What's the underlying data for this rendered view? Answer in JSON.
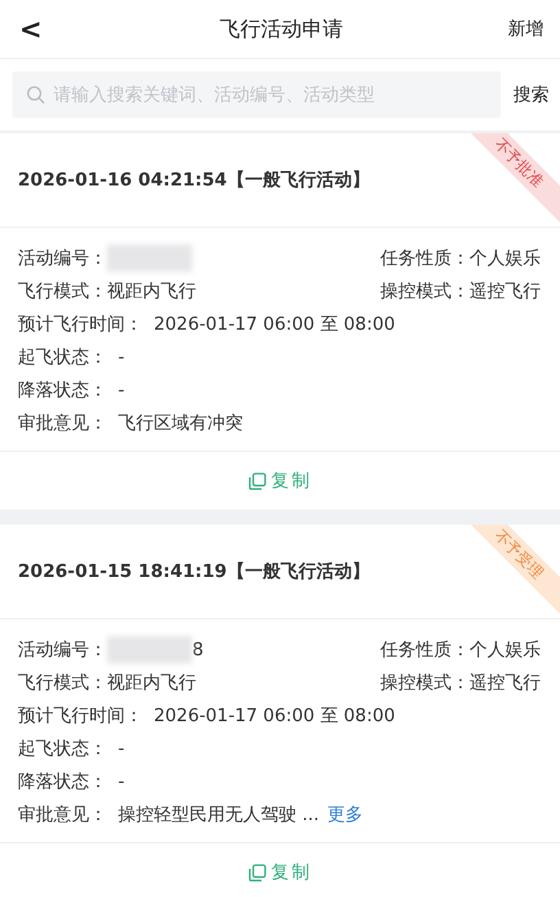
{
  "header": {
    "back": "<",
    "title": "飞行活动申请",
    "action": "新增"
  },
  "search": {
    "placeholder": "请输入搜索关键词、活动编号、活动类型",
    "button": "搜索"
  },
  "cards": [
    {
      "title": "2026-01-16 04:21:54【一般飞行活动】",
      "status": {
        "kind": "rejected",
        "text": "不予批准"
      },
      "number_label": "活动编号：",
      "number_redacted": true,
      "task_label": "任务性质：",
      "task": "个人娱乐",
      "flight_mode_label": "飞行模式：",
      "flight_mode": "视距内飞行",
      "control_label": "操控模式：",
      "control": "遥控飞行",
      "time_label": "预计飞行时间：",
      "time": "2026-01-17 06:00 至 08:00",
      "takeoff_label": "起飞状态：",
      "takeoff": "-",
      "landing_label": "降落状态：",
      "landing": "-",
      "opinion_label": "审批意见：",
      "opinion": "飞行区域有冲突",
      "copy": "复制"
    },
    {
      "title": "2026-01-15 18:41:19【一般飞行活动】",
      "status": {
        "kind": "not_accepted",
        "text": "不予受理"
      },
      "number_label": "活动编号：",
      "number_redacted": true,
      "number_visible": "8",
      "task_label": "任务性质：",
      "task": "个人娱乐",
      "flight_mode_label": "飞行模式：",
      "flight_mode": "视距内飞行",
      "control_label": "操控模式：",
      "control": "遥控飞行",
      "time_label": "预计飞行时间：",
      "time": "2026-01-17 06:00 至 08:00",
      "takeoff_label": "起飞状态：",
      "takeoff": "-",
      "landing_label": "降落状态：",
      "landing": "-",
      "opinion_label": "审批意见：",
      "opinion": "操控轻型民用无人驾驶 ...",
      "more": "更多",
      "copy": "复制"
    }
  ]
}
